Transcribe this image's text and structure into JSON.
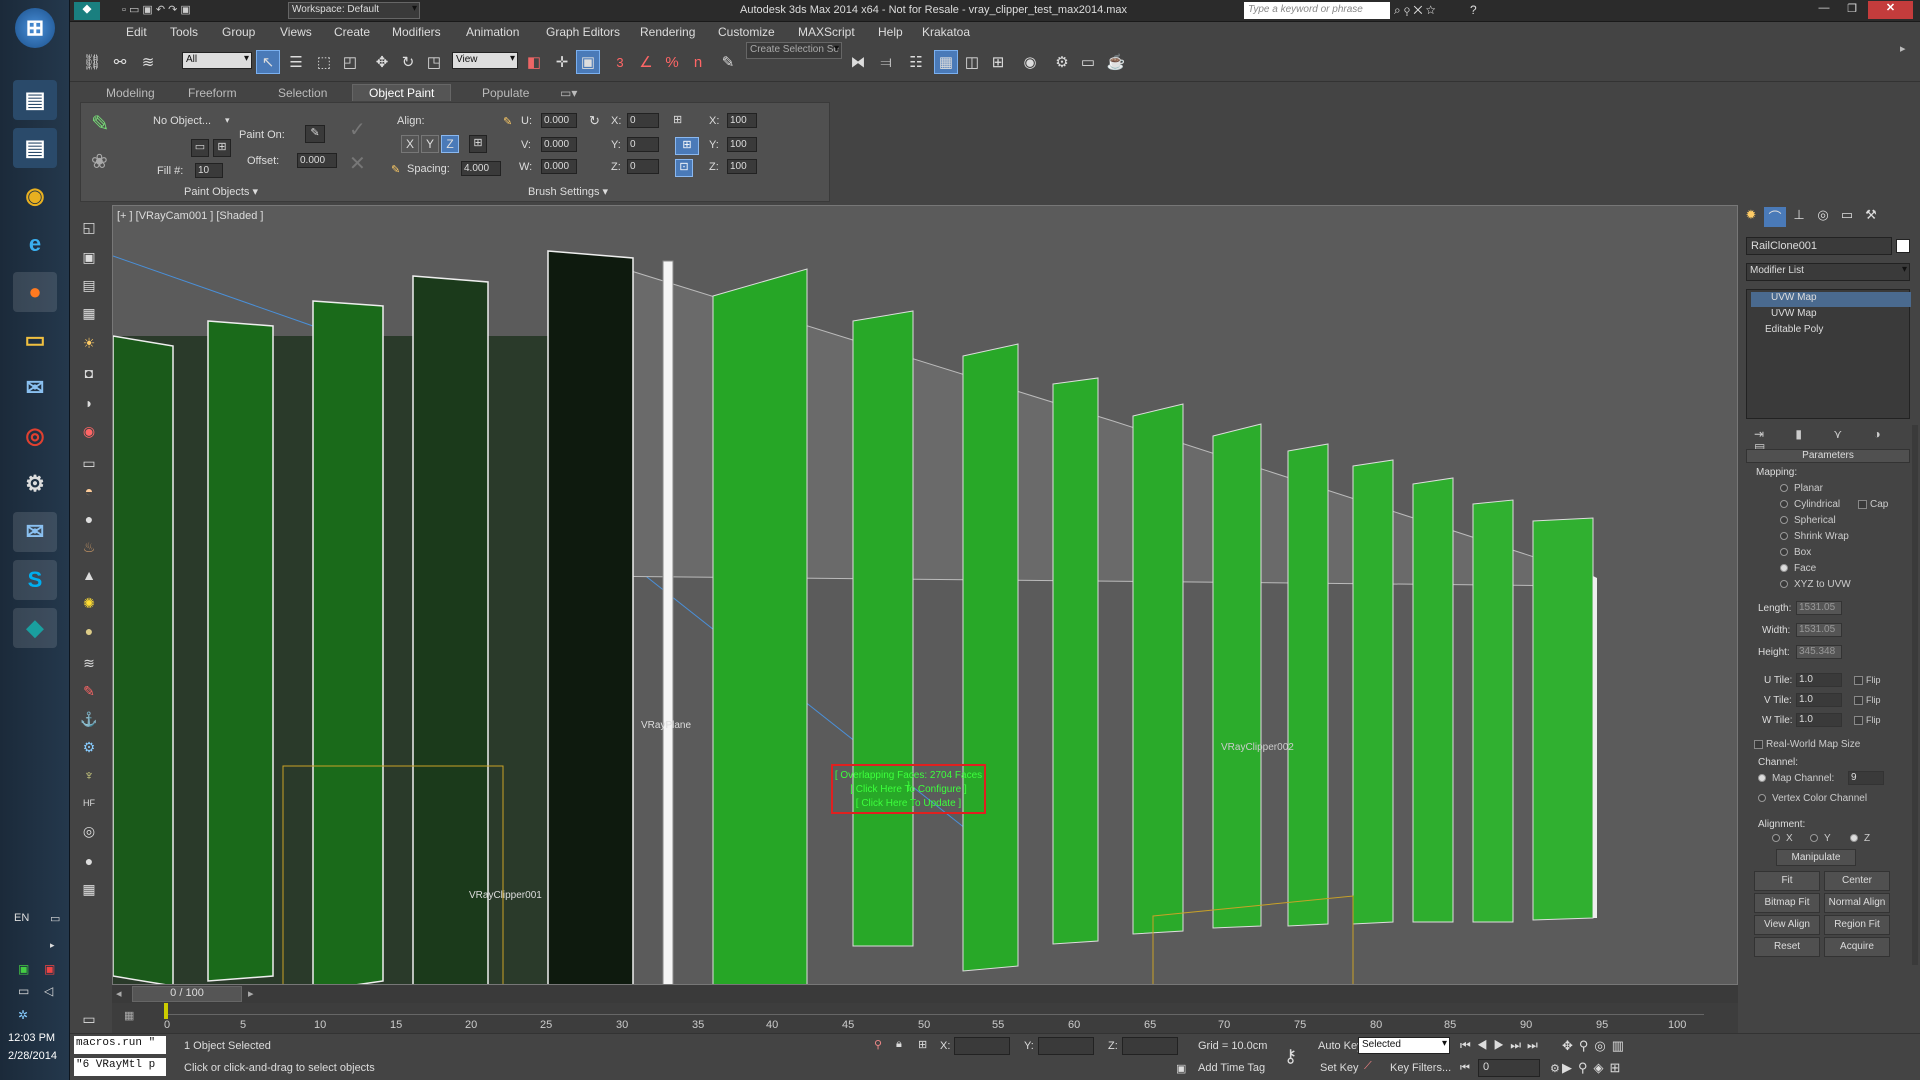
{
  "window": {
    "title": "Autodesk 3ds Max  2014 x64   - Not for Resale -   vray_clipper_test_max2014.max",
    "workspace": "Workspace: Default",
    "search_placeholder": "Type a keyword or phrase"
  },
  "menu": [
    "Edit",
    "Tools",
    "Group",
    "Views",
    "Create",
    "Modifiers",
    "Animation",
    "Graph Editors",
    "Rendering",
    "Customize",
    "MAXScript",
    "Help",
    "Krakatoa"
  ],
  "toolbar": {
    "selection_filter": "All",
    "ref_coord": "View",
    "named_selection": "Create Selection Se",
    "snap_3": "3",
    "snap_percent": "%",
    "snap_n": "n"
  },
  "ribbon": {
    "tabs": [
      "Modeling",
      "Freeform",
      "Selection",
      "Object Paint",
      "Populate"
    ],
    "active_tab": "Object Paint",
    "no_object": "No Object...",
    "paint_on": "Paint On:",
    "offset_label": "Offset:",
    "offset_value": "0.000",
    "fill_label": "Fill #:",
    "fill_value": "10",
    "paint_objects": "Paint Objects",
    "align_label": "Align:",
    "axis_x": "X",
    "axis_y": "Y",
    "axis_z": "Z",
    "spacing_label": "Spacing:",
    "spacing_value": "4.000",
    "u_label": "U:",
    "u_value": "0.000",
    "v_label": "V:",
    "v_value": "0.000",
    "w_label": "W:",
    "w_value": "0.000",
    "rx_label": "X:",
    "rx_value": "0",
    "ry_label": "Y:",
    "ry_value": "0",
    "rz_label": "Z:",
    "rz_value": "0",
    "sx_label": "X:",
    "sx_value": "100",
    "sy_label": "Y:",
    "sy_value": "100",
    "sz_label": "Z:",
    "sz_value": "100",
    "brush_settings": "Brush Settings"
  },
  "viewport": {
    "label": "[+ ] [VRayCam001 ] [Shaded ]",
    "objects": [
      "VRayPlane",
      "VRayClipper001",
      "VRayClipper002"
    ],
    "warning": [
      "[ Overlapping Faces: 2704 Faces ]",
      "[ Click Here To Configure ]",
      "[ Click Here To Update ]"
    ],
    "colors": {
      "panel": "#1f9f1f",
      "panel_dark": "#0f4f0f",
      "dark_panel": "#1b241b",
      "background": "#5b5b5b"
    }
  },
  "timeline": {
    "frame": "0 / 100",
    "ticks": [
      "0",
      "5",
      "10",
      "15",
      "20",
      "25",
      "30",
      "35",
      "40",
      "45",
      "50",
      "55",
      "60",
      "65",
      "70",
      "75",
      "80",
      "85",
      "90",
      "95",
      "100"
    ]
  },
  "cmdpanel": {
    "object_name": "RailClone001",
    "modifier_list": "Modifier List",
    "stack": [
      "UVW Map",
      "UVW Map",
      "Editable Poly"
    ],
    "rollout": "Parameters",
    "mapping_label": "Mapping:",
    "mapping_options": [
      "Planar",
      "Cylindrical",
      "Spherical",
      "Shrink Wrap",
      "Box",
      "Face",
      "XYZ to UVW"
    ],
    "mapping_selected": "Face",
    "cap_label": "Cap",
    "length_label": "Length:",
    "length_value": "1531.05",
    "width_label": "Width:",
    "width_value": "1531.05",
    "height_label": "Height:",
    "height_value": "345.348",
    "utile_label": "U Tile:",
    "utile_value": "1.0",
    "vtile_label": "V Tile:",
    "vtile_value": "1.0",
    "wtile_label": "W Tile:",
    "wtile_value": "1.0",
    "flip_label": "Flip",
    "realworld_label": "Real-World Map Size",
    "channel_label": "Channel:",
    "map_channel_label": "Map Channel:",
    "map_channel_value": "9",
    "vertex_color_label": "Vertex Color Channel",
    "alignment_label": "Alignment:",
    "align_x": "X",
    "align_y": "Y",
    "align_z": "Z",
    "buttons": [
      "Manipulate",
      "Fit",
      "Center",
      "Bitmap Fit",
      "Normal Align",
      "View Align",
      "Region Fit",
      "Reset",
      "Acquire"
    ]
  },
  "status": {
    "macro1": "macros.run \"",
    "macro2": "\"6 VRayMtl p",
    "selected": "1 Object Selected",
    "prompt": "Click or click-and-drag to select objects",
    "x_label": "X:",
    "y_label": "Y:",
    "z_label": "Z:",
    "grid": "Grid = 10.0cm",
    "add_time_tag": "Add Time Tag",
    "auto_key": "Auto Key",
    "set_key": "Set Key",
    "key_mode": "Selected",
    "key_filters": "Key Filters...",
    "current_frame": "0"
  },
  "system_tray": {
    "lang": "EN",
    "time": "12:03 PM",
    "date": "2/28/2014"
  }
}
